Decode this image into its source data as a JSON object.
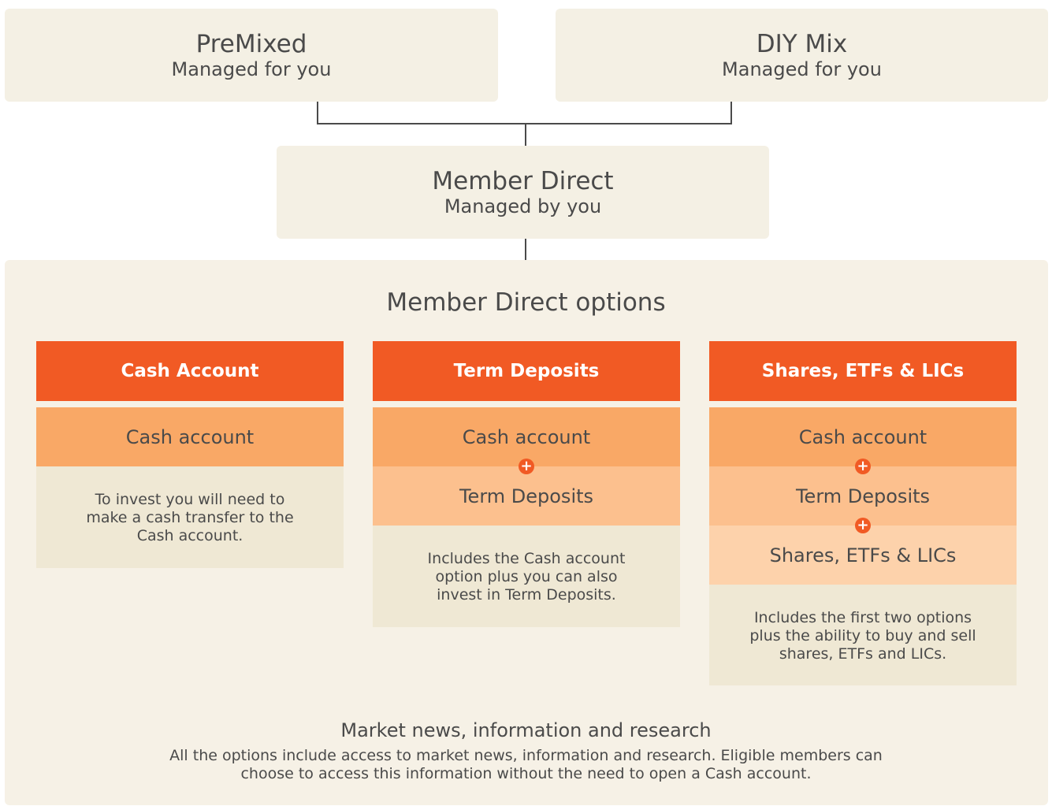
{
  "top_boxes": {
    "premixed": {
      "title": "PreMixed",
      "subtitle": "Managed for you"
    },
    "diy_mix": {
      "title": "DIY Mix",
      "subtitle": "Managed for you"
    },
    "member_direct": {
      "title": "Member Direct",
      "subtitle": "Managed by you"
    }
  },
  "options": {
    "title": "Member Direct options",
    "columns": [
      {
        "header": "Cash Account",
        "tiers": [
          "Cash account"
        ],
        "description": "To invest you will need to make a cash transfer to the Cash account."
      },
      {
        "header": "Term Deposits",
        "tiers": [
          "Cash account",
          "Term Deposits"
        ],
        "description": "Includes the Cash account option plus you can also invest in Term Deposits."
      },
      {
        "header": "Shares, ETFs & LICs",
        "tiers": [
          "Cash account",
          "Term Deposits",
          "Shares, ETFs & LICs"
        ],
        "description": "Includes the first two options plus the ability to buy and sell shares, ETFs and LICs."
      }
    ],
    "plus_symbol": "+"
  },
  "market": {
    "title": "Market news, information and research",
    "text": "All the options include access to market news, information and research. Eligible members can choose to access this information without the need to open a Cash account."
  },
  "colors": {
    "header_orange": "#f15a24",
    "tier_1": "#f9a866",
    "tier_2": "#fcc08e",
    "tier_3": "#fdd2ab",
    "description_bg": "#efe8d4",
    "panel_bg": "#f4f0e4"
  }
}
